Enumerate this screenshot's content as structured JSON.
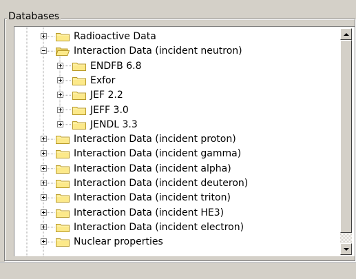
{
  "panel": {
    "title": "Databases"
  },
  "tree": [
    {
      "label": "Radioactive Data",
      "level": 0,
      "expanded": false,
      "open_folder": false
    },
    {
      "label": "Interaction Data (incident neutron)",
      "level": 0,
      "expanded": true,
      "open_folder": true
    },
    {
      "label": "ENDFB 6.8",
      "level": 1,
      "expanded": false,
      "open_folder": false
    },
    {
      "label": "Exfor",
      "level": 1,
      "expanded": false,
      "open_folder": false
    },
    {
      "label": "JEF 2.2",
      "level": 1,
      "expanded": false,
      "open_folder": false
    },
    {
      "label": "JEFF 3.0",
      "level": 1,
      "expanded": false,
      "open_folder": false
    },
    {
      "label": "JENDL 3.3",
      "level": 1,
      "expanded": false,
      "open_folder": false
    },
    {
      "label": "Interaction Data (incident proton)",
      "level": 0,
      "expanded": false,
      "open_folder": false
    },
    {
      "label": "Interaction Data (incident gamma)",
      "level": 0,
      "expanded": false,
      "open_folder": false
    },
    {
      "label": "Interaction Data (incident alpha)",
      "level": 0,
      "expanded": false,
      "open_folder": false
    },
    {
      "label": "Interaction Data (incident deuteron)",
      "level": 0,
      "expanded": false,
      "open_folder": false
    },
    {
      "label": "Interaction Data (incident triton)",
      "level": 0,
      "expanded": false,
      "open_folder": false
    },
    {
      "label": "Interaction Data (incident HE3)",
      "level": 0,
      "expanded": false,
      "open_folder": false
    },
    {
      "label": "Interaction Data (incident electron)",
      "level": 0,
      "expanded": false,
      "open_folder": false
    },
    {
      "label": "Nuclear properties",
      "level": 0,
      "expanded": false,
      "open_folder": false
    }
  ],
  "icons": {
    "expander_collapsed": "plus-box-icon",
    "expander_expanded": "minus-box-icon",
    "folder": "folder-icon",
    "folder_open": "folder-open-icon",
    "scroll_up": "arrow-up-icon",
    "scroll_down": "arrow-down-icon"
  },
  "colors": {
    "window_bg": "#d4d0c8",
    "tree_bg": "#ffffff",
    "folder_fill": "#fce98a",
    "folder_border": "#b89a2a"
  }
}
